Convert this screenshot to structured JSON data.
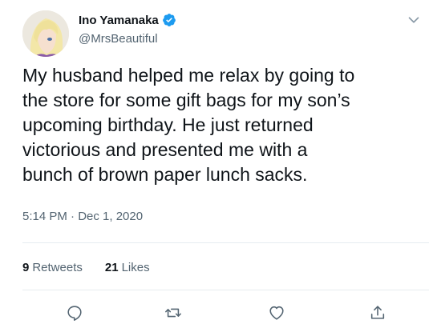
{
  "author": {
    "name": "Ino Yamanaka",
    "handle": "@MrsBeautiful",
    "verified_icon": "verified-badge-icon"
  },
  "tweet": {
    "text": "My husband helped me relax by going to\nthe store for some gift bags for my son’s\nupcoming birthday. He just returned\nvictorious and presented me with a\nbunch of brown paper lunch sacks.",
    "timestamp": "5:14 PM · Dec 1, 2020"
  },
  "stats": {
    "retweets_count": "9",
    "retweets_label": "Retweets",
    "likes_count": "21",
    "likes_label": "Likes"
  },
  "actions": [
    "reply-icon",
    "retweet-icon",
    "like-icon",
    "share-icon"
  ],
  "colors": {
    "accent": "#1d9bf0",
    "secondary_text": "#536471",
    "primary_text": "#0f1419",
    "divider": "#e6ecf0"
  }
}
